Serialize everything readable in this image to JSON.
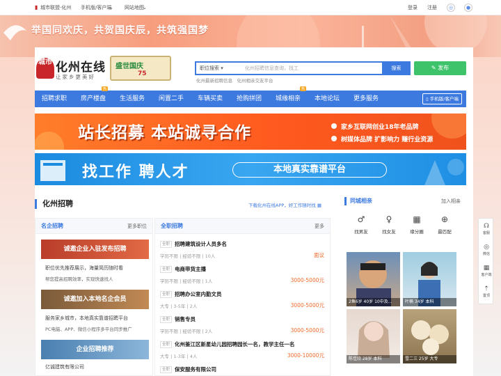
{
  "topbar": {
    "city": "城市联盟·化州",
    "mobile": "手机版/客户端",
    "sitemap": "网站地图",
    "login": "登录",
    "register": "注册"
  },
  "hero": {
    "slogan": "举国同欢庆，共贺国庆辰，共筑强国梦"
  },
  "logo": {
    "seal": "城市",
    "name": "化州在线",
    "subtitle": "让家乡更美好"
  },
  "promo": {
    "line1": "盛世国庆",
    "line2": "75"
  },
  "search": {
    "category": "职位搜索",
    "placeholder": "化州招聘信息查询，找工作，就上化州在线",
    "button": "搜索",
    "hot": "化州最新招聘信息　化州相亲交友平台"
  },
  "post_button": "发布",
  "nav": {
    "items": [
      "招聘求职",
      "房产楼盘",
      "生活服务",
      "闲置二手",
      "车辆买卖",
      "抢购拼团",
      "城缘相亲",
      "本地论坛",
      "更多服务"
    ],
    "badge1": "热",
    "badge2": "热",
    "app": "手机版/客户端"
  },
  "banner1": {
    "title": "站长招募 本站诚寻合作",
    "line1": "家乡互联网创业18年老品牌",
    "line2": "树媒体品牌 扩影响力 赚行业资源"
  },
  "banner2": {
    "title": "找工作 聘人才",
    "pill": "本地真实靠谱平台"
  },
  "section": {
    "title": "化州招聘",
    "download": "下载化州在线APP，好工作随时找"
  },
  "famous": {
    "title": "名企招聘",
    "more": "更多职位",
    "card1": "诚邀企业入驻发布招聘",
    "text1a": "职位优先推荐展示，海量简历随时看",
    "text1b": "帮您提高招聘效率，实现快速找人",
    "card2": "诚邀加入本地名企会员",
    "text2a": "服务家乡城市，本地真实靠谱招聘平台",
    "text2b": "PC电脑、APP、微信小程序多平台同步推广",
    "card3": "企业招聘推荐",
    "text3": "亿诚建筑有限公司"
  },
  "jobs": {
    "title": "全职招聘",
    "more": "更多",
    "tag": "全职",
    "list": [
      {
        "title": "招聘建筑设计人员多名",
        "meta": "学历不限 | 经验不限 | 10人",
        "salary": "面议"
      },
      {
        "title": "电商带货主播",
        "meta": "学历不限 | 经验不限 | 1人",
        "salary": "3000-5000元"
      },
      {
        "title": "招聘办公室内勤文员",
        "meta": "大专 | 3-5年 | 2人",
        "salary": "3000-5000元"
      },
      {
        "title": "销售专员",
        "meta": "学历不限 | 经验不限 | 2人",
        "salary": "3000-5000元"
      },
      {
        "title": "化州鉴江区新星幼儿园招聘园长一名，教学主任一名",
        "meta": "大专 | 1-3年 | 4人",
        "salary": "3000-10000元"
      },
      {
        "title": "保安服务有限公司",
        "meta": "",
        "salary": ""
      }
    ]
  },
  "dating": {
    "title": "同城相亲",
    "more": "加入相亲",
    "quick": [
      "找男友",
      "找女友",
      "缘分圈",
      "最匹配"
    ],
    "photos": [
      {
        "caption": "2鱼6岁 40岁 10中及..."
      },
      {
        "caption": "叶楠 34岁 本科"
      },
      {
        "caption": "陈佳欣 28岁 本科"
      },
      {
        "caption": "雪二三 25岁 大专"
      }
    ]
  },
  "float": {
    "service": "客服",
    "wechat": "微信",
    "app": "客户端",
    "top": "置顶"
  },
  "colors": {
    "primary": "#3d7ae0",
    "post": "#3fc36a",
    "salary": "#f06a2a"
  }
}
